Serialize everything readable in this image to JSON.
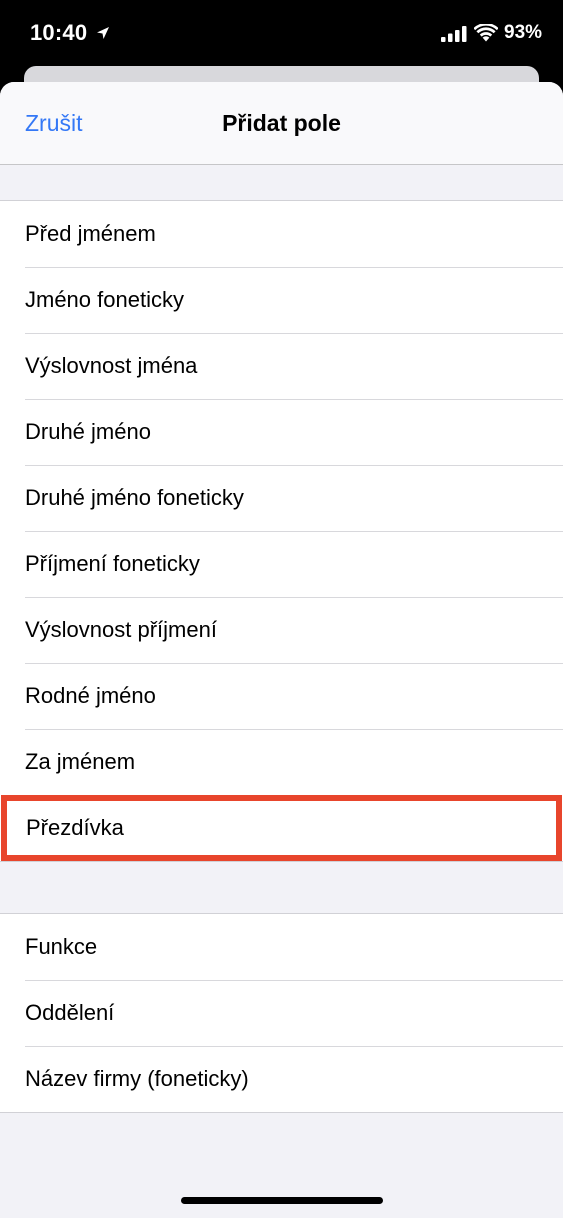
{
  "status_bar": {
    "time": "10:40",
    "battery": "93%",
    "icons": [
      "location-arrow-icon",
      "cellular-signal-icon",
      "wifi-icon"
    ]
  },
  "nav": {
    "cancel_label": "Zrušit",
    "title": "Přidat pole"
  },
  "groups": [
    {
      "items": [
        "Před jménem",
        "Jméno foneticky",
        "Výslovnost jména",
        "Druhé jméno",
        "Druhé jméno foneticky",
        "Příjmení foneticky",
        "Výslovnost příjmení",
        "Rodné jméno",
        "Za jménem",
        "Přezdívka"
      ]
    },
    {
      "items": [
        "Funkce",
        "Oddělení",
        "Název firmy (foneticky)"
      ]
    }
  ],
  "highlight": {
    "item": "Přezdívka",
    "color": "#e8452c"
  },
  "colors": {
    "accent": "#3478f6",
    "background": "#f2f2f7"
  }
}
